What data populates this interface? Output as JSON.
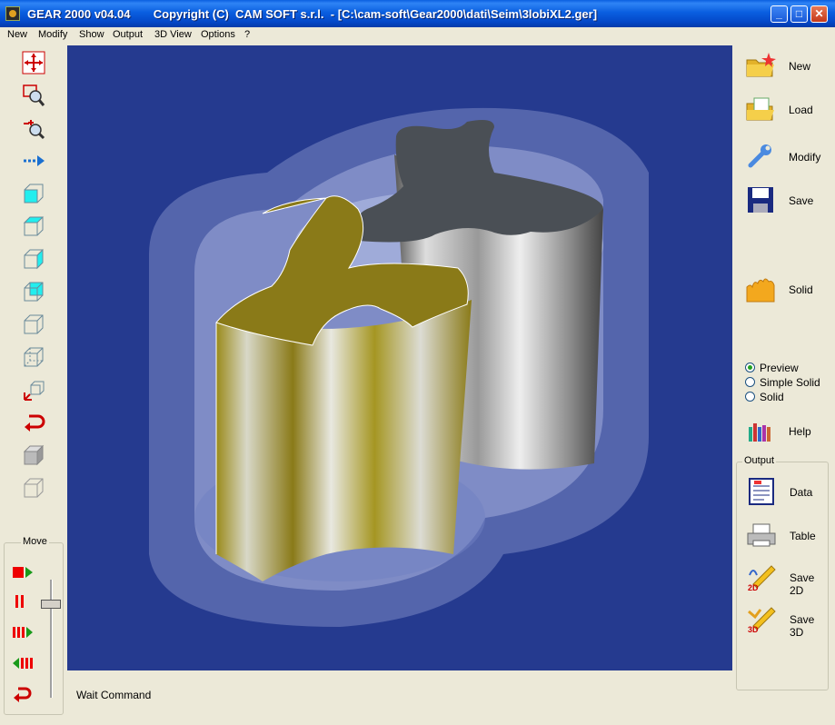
{
  "window": {
    "title": "GEAR 2000 v04.04       Copyright (C)  CAM SOFT s.r.l.  - [C:\\cam-soft\\Gear2000\\dati\\Seim\\3lobiXL2.ger]",
    "minimize": "_",
    "maximize": "□",
    "close": "✕"
  },
  "menu": [
    "New",
    "Modify",
    "Show",
    "Output",
    "3D View",
    "Options",
    "?"
  ],
  "left_toolbar": [
    "move-view-icon",
    "zoom-window-icon",
    "zoom-in-out-icon",
    "pan-arrow-icon",
    "view-front-icon",
    "view-top-icon",
    "view-right-icon",
    "view-iso-1-icon",
    "view-iso-2-icon",
    "view-iso-3-icon",
    "rotate-axes-icon",
    "undo-view-icon",
    "solid-box-icon",
    "wire-box-icon"
  ],
  "move": {
    "label": "Move",
    "buttons": [
      "play-icon",
      "pause-icon",
      "fast-forward-icon",
      "rewind-icon",
      "return-icon"
    ]
  },
  "right_panel": {
    "new": "New",
    "load": "Load",
    "modify": "Modify",
    "save": "Save",
    "solid": "Solid",
    "radio": [
      "Preview",
      "Simple Solid",
      "Solid"
    ],
    "radio_selected": "Preview",
    "help": "Help",
    "output": {
      "label": "Output",
      "data": "Data",
      "table": "Table",
      "save2d": "Save 2D",
      "save3d": "Save 3D"
    }
  },
  "status": "Wait Command",
  "colors": {
    "viewport_bg": "#253a8f",
    "gear_gold": "#8a7a18",
    "gear_gray": "#4a4f55"
  }
}
